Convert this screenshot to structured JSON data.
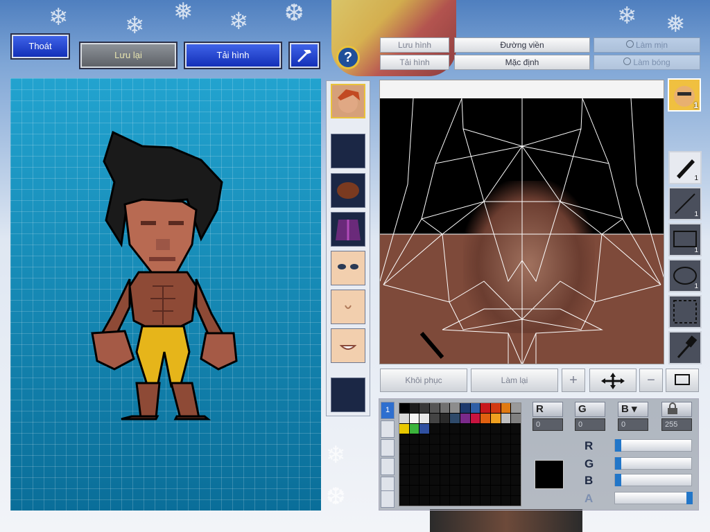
{
  "toolbar": {
    "exit_label": "Thoát",
    "save_label": "Lưu lại",
    "reload_label": "Tải hình"
  },
  "editor_tabs": {
    "save_image": "Lưu hình",
    "load_image": "Tải hình",
    "outline": "Đường viền",
    "default": "Mặc định",
    "smooth": "Làm mịn",
    "shine": "Làm bóng"
  },
  "avatar_badge": "1",
  "tools": [
    {
      "name": "pen",
      "count": "1"
    },
    {
      "name": "line",
      "count": "1"
    },
    {
      "name": "rectangle",
      "count": "1"
    },
    {
      "name": "ellipse",
      "count": "1"
    },
    {
      "name": "selection",
      "count": ""
    },
    {
      "name": "eyedropper",
      "count": ""
    }
  ],
  "bottom_buttons": {
    "restore": "Khôi phục",
    "redo": "Làm lại"
  },
  "palette_tab": "1",
  "channels": {
    "r_header": "R",
    "g_header": "G",
    "b_header": "B",
    "r_value": "0",
    "g_value": "0",
    "b_value": "0",
    "a_value": "255"
  },
  "slider_labels": {
    "r": "R",
    "g": "G",
    "b": "B",
    "a": "A"
  },
  "sliders": {
    "r": 0,
    "g": 0,
    "b": 0,
    "a": 1
  },
  "current_color": "#000000",
  "palette_colors": [
    "#000000",
    "#1c1c1c",
    "#383838",
    "#555555",
    "#717171",
    "#8d8d8d",
    "#1d3a6e",
    "#2f5fa6",
    "#c8181c",
    "#d23a12",
    "#e07a12",
    "#9a9a9a",
    "#d8d8d8",
    "#f4f4f4",
    "#e8e8e8",
    "#444444",
    "#2a2a2a",
    "#2f4a6a",
    "#7a2a8a",
    "#c81440",
    "#e06010",
    "#f0a020",
    "#c0c0c0",
    "#808080",
    "#e8c800",
    "#3cb43c",
    "#3050a0"
  ]
}
